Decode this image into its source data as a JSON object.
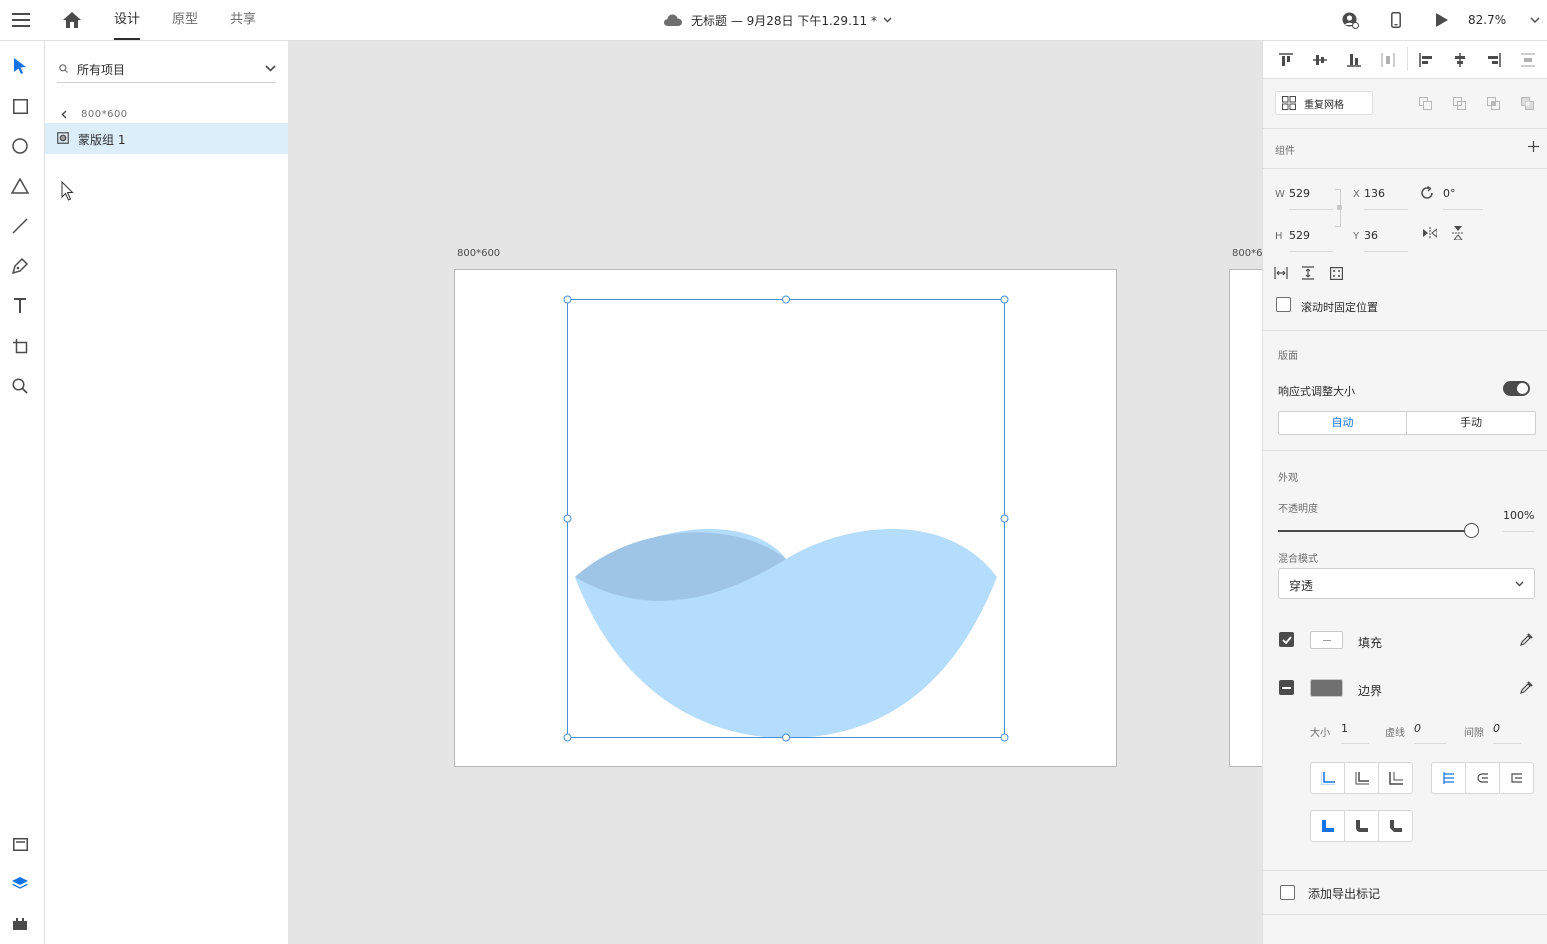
{
  "topbar": {
    "tabs": [
      {
        "label": "设计"
      },
      {
        "label": "原型"
      },
      {
        "label": "共享"
      }
    ],
    "doc_title": "无标题 — 9月28日 下午1.29.11 *",
    "zoom": "82.7%"
  },
  "layers": {
    "search_placeholder": "所有项目",
    "breadcrumb": "800*600",
    "items": [
      {
        "label": "蒙版组 1"
      }
    ]
  },
  "canvas": {
    "artboard_label": "800*600",
    "artboard2_label": "800*6",
    "colors": {
      "light_blue": "#b4dcfc",
      "dark_blue": "#9ec4e6",
      "selection": "#4a8fd1"
    }
  },
  "inspector": {
    "repeat_grid": "重复网格",
    "component_label": "组件",
    "w_label": "W",
    "w": "529",
    "h_label": "H",
    "h": "529",
    "x_label": "X",
    "x": "136",
    "y_label": "Y",
    "y": "36",
    "rotation": "0°",
    "fix_scroll": "滚动时固定位置",
    "layout_label": "版面",
    "responsive": "响应式调整大小",
    "auto": "自动",
    "manual": "手动",
    "appearance": "外观",
    "opacity_label": "不透明度",
    "opacity": "100%",
    "opacity_value": 1.0,
    "blend_label": "混合模式",
    "blend": "穿透",
    "fill": "填充",
    "border": "边界",
    "size_label": "大小",
    "size": "1",
    "dash_label": "虚线",
    "dash": "0",
    "gap_label": "间隙",
    "gap": "0",
    "export_mark": "添加导出标记"
  }
}
